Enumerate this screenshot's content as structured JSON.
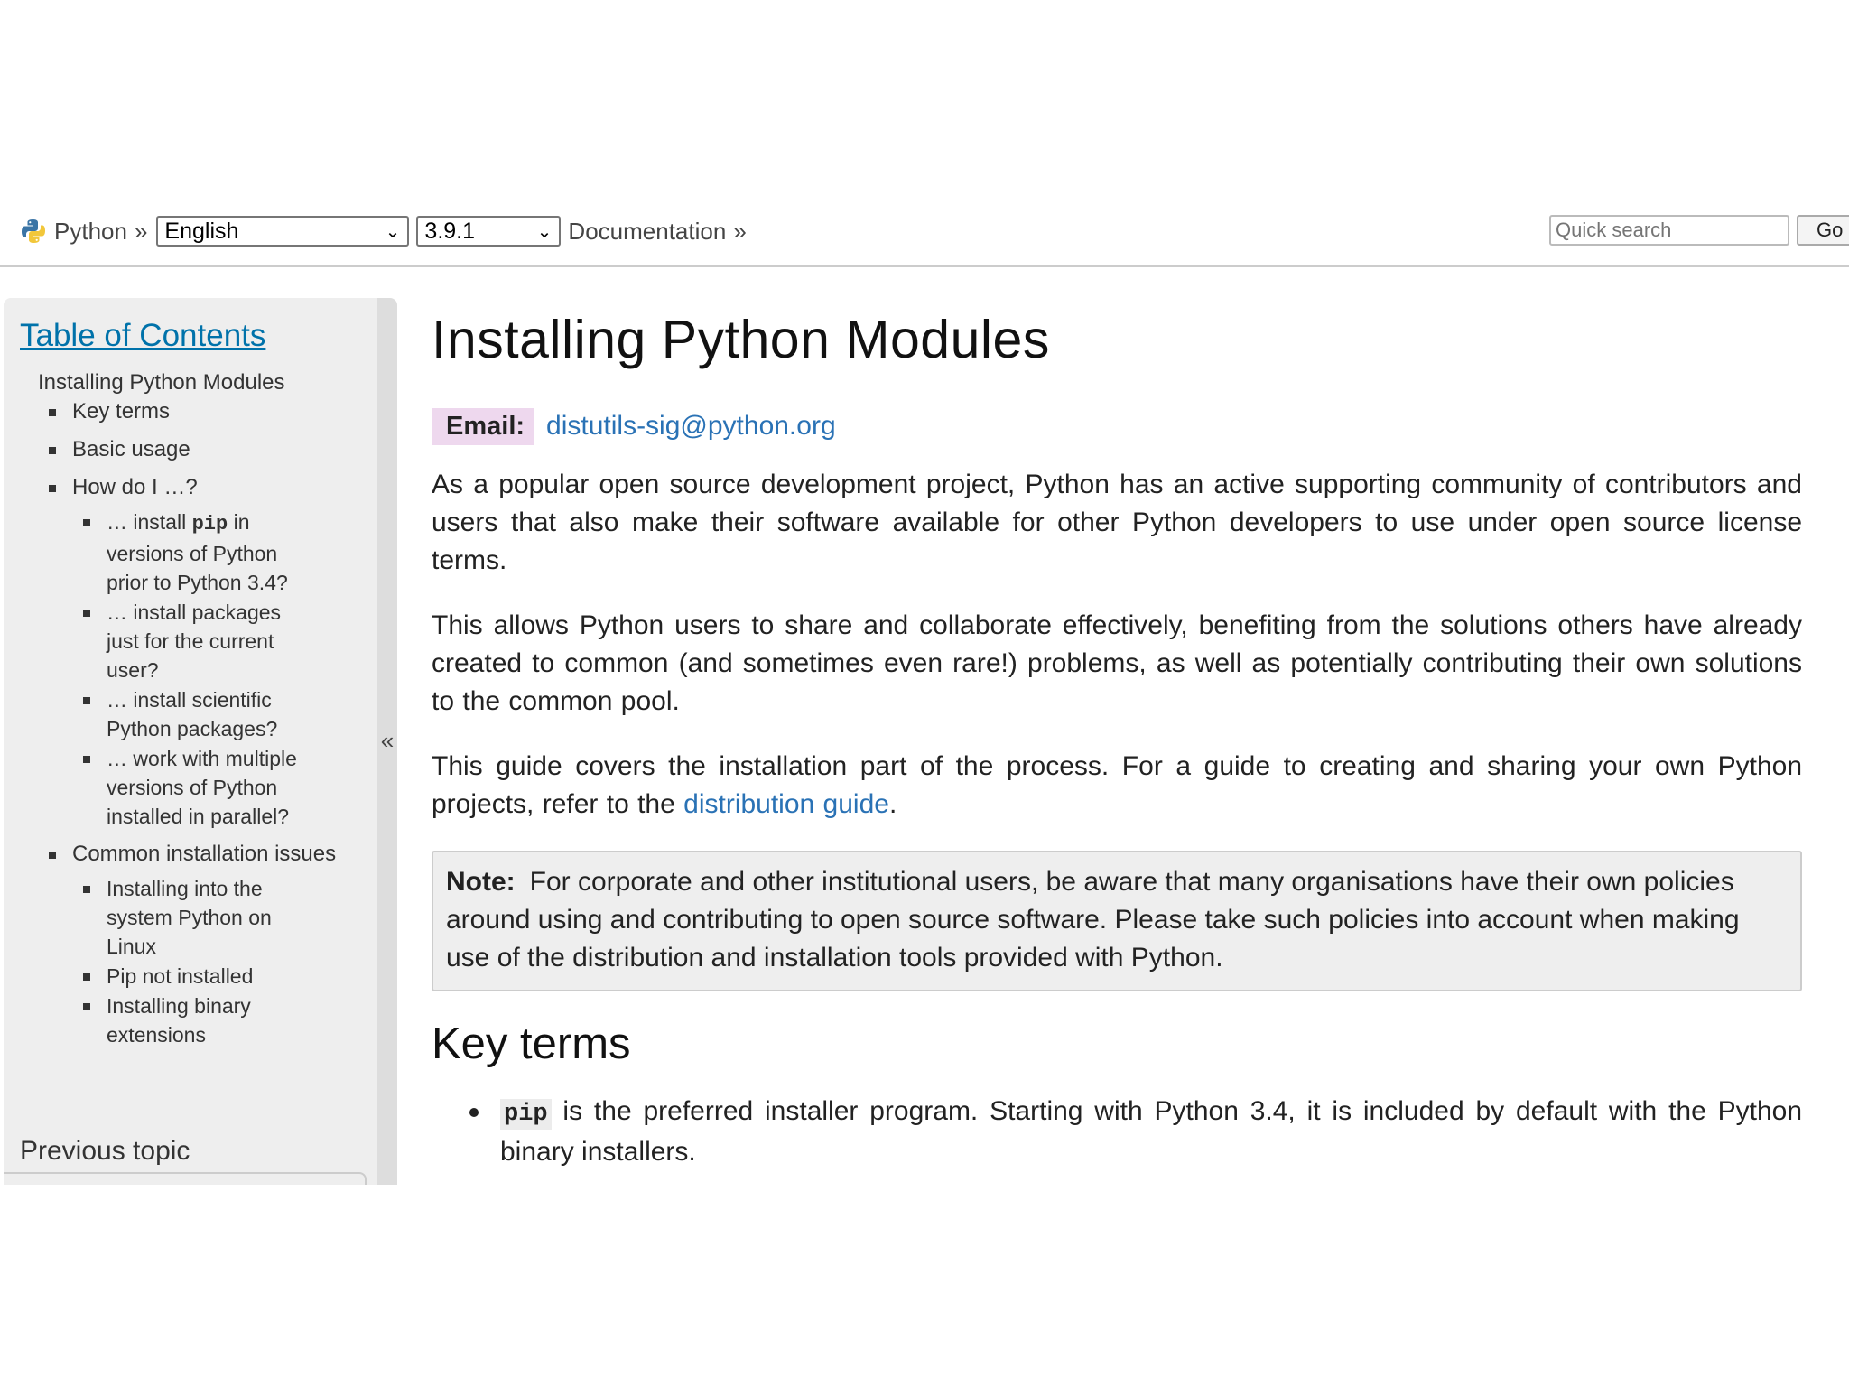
{
  "nav": {
    "python_label": "Python",
    "separator": "»",
    "language_value": "English",
    "version_value": "3.9.1",
    "docs_label": "Documentation",
    "search_placeholder": "Quick search",
    "go_label": "Go"
  },
  "sidebar": {
    "toc_title": "Table of Contents",
    "root_item": "Installing Python Modules",
    "items": [
      {
        "label": "Key terms"
      },
      {
        "label": "Basic usage"
      },
      {
        "label": "How do I …?",
        "children": [
          {
            "prefix": "… install ",
            "code": "pip",
            "suffix": " in versions of Python prior to Python 3.4?"
          },
          {
            "label": "… install packages just for the current user?"
          },
          {
            "label": "… install scientific Python packages?"
          },
          {
            "label": "… work with multiple versions of Python installed in parallel?"
          }
        ]
      },
      {
        "label": "Common installation issues",
        "children": [
          {
            "label": "Installing into the system Python on Linux"
          },
          {
            "label": "Pip not installed"
          },
          {
            "label": "Installing binary extensions"
          }
        ]
      }
    ],
    "collapse_glyph": "«",
    "previous_topic": "Previous topic"
  },
  "main": {
    "title": "Installing Python Modules",
    "email_label": "Email:",
    "email_value": "distutils-sig@python.org",
    "para1": "As a popular open source development project, Python has an active supporting community of contributors and users that also make their software available for other Python developers to use under open source license terms.",
    "para2": "This allows Python users to share and collaborate effectively, benefiting from the solutions others have already created to common (and sometimes even rare!) problems, as well as potentially contributing their own solutions to the common pool.",
    "para3_before": "This guide covers the installation part of the process. For a guide to creating and sharing your own Python projects, refer to the ",
    "para3_link": "distribution guide",
    "para3_after": ".",
    "note_label": "Note:",
    "note_text": "For corporate and other institutional users, be aware that many organisations have their own policies around using and contributing to open source software. Please take such policies into account when making use of the distribution and installation tools provided with Python.",
    "key_terms_heading": "Key terms",
    "key_term1_code": "pip",
    "key_term1_text": " is the preferred installer program. Starting with Python 3.4, it is included by default with the Python binary installers."
  },
  "colors": {
    "link": "#2a72b5",
    "toc_link": "#0072aa",
    "sidebar_bg": "#eeeeee",
    "email_label_bg": "#eed8ee",
    "note_bg": "#eeeeee"
  }
}
